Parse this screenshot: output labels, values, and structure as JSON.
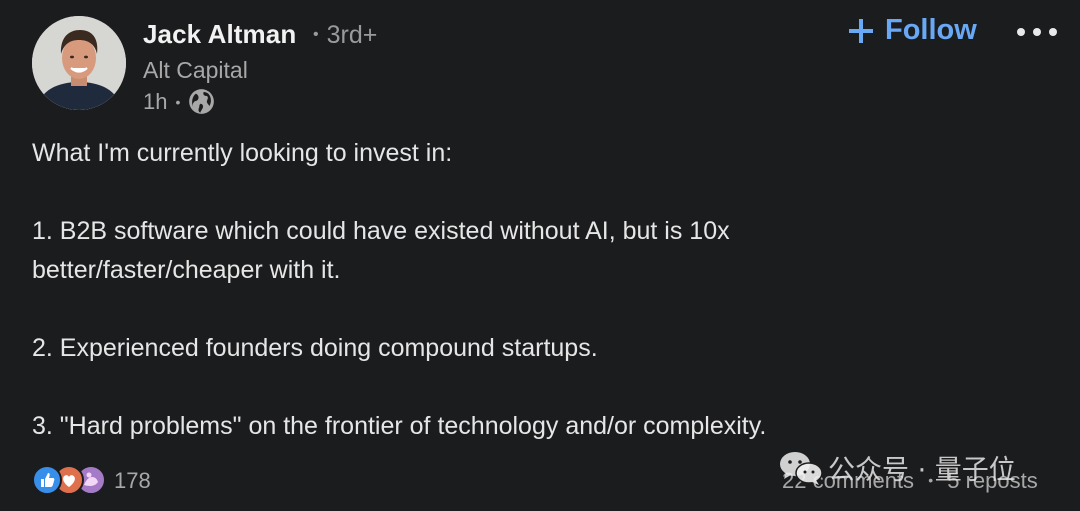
{
  "author": {
    "name": "Jack Altman",
    "degree": "3rd+",
    "company": "Alt Capital",
    "time": "1h",
    "visibility_icon": "globe-icon"
  },
  "actions": {
    "follow_label": "Follow",
    "follow_icon": "plus-icon",
    "more_icon": "more-icon"
  },
  "post": {
    "paragraphs": [
      "What I'm currently looking to invest in:",
      "1. B2B software which could have existed without AI, but is 10x better/faster/cheaper with it.",
      "2. Experienced founders doing compound startups.",
      "3. \"Hard problems\" on the frontier of technology and/or complexity."
    ]
  },
  "social": {
    "reaction_icons": [
      "like-icon",
      "love-icon",
      "insightful-icon"
    ],
    "reaction_count": "178",
    "comments": "22 comments",
    "reposts": "5 reposts"
  },
  "watermark": {
    "text": "公众号 · 量子位",
    "icon": "wechat-icon"
  },
  "colors": {
    "background": "#1b1c1e",
    "accent": "#69a8f5",
    "primary_text": "#e6e6e6",
    "secondary_text": "#a8a8a8"
  }
}
